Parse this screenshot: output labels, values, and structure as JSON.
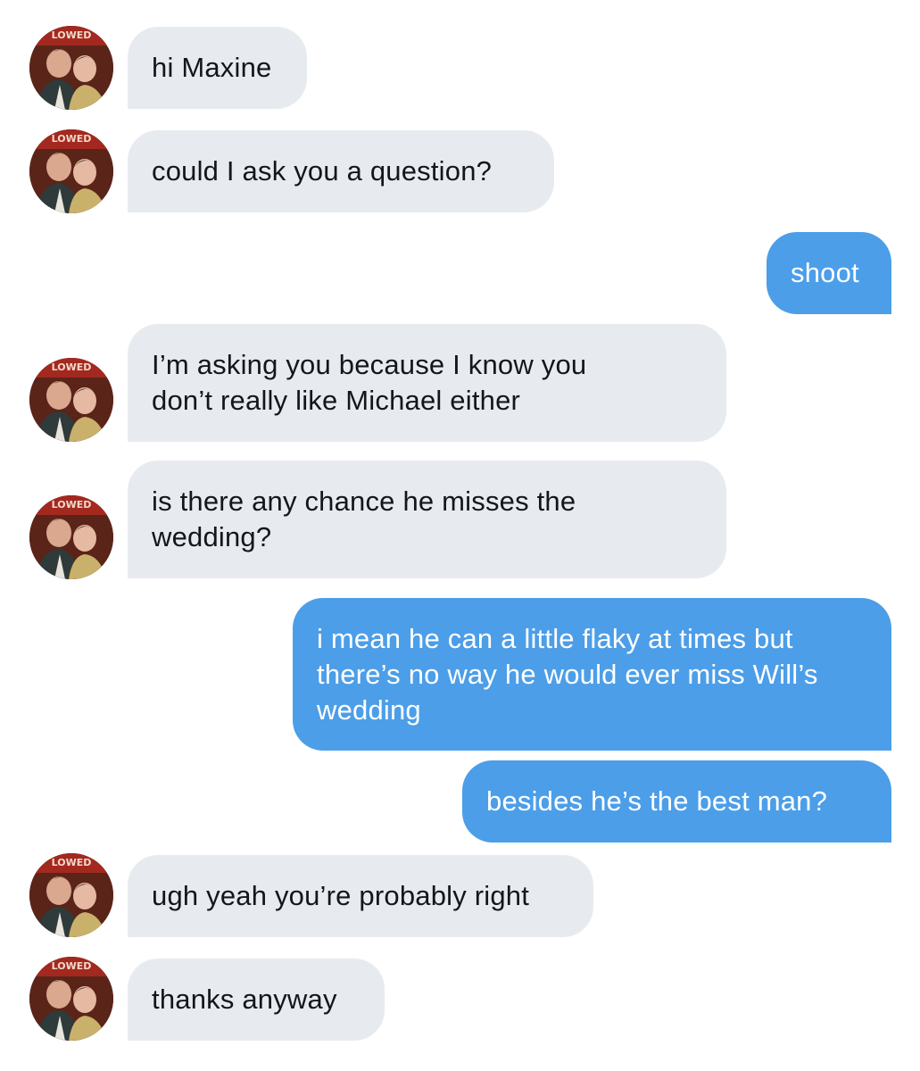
{
  "colors": {
    "incoming_bubble": "#e7ebef",
    "outgoing_bubble": "#4c9ee8",
    "incoming_text": "#14171a",
    "outgoing_text": "#ffffff"
  },
  "avatar": {
    "icon": "avatar-photo-icon",
    "badge_text": "LOWED"
  },
  "conversation": {
    "messages": [
      {
        "sender": "them",
        "text": "hi Maxine"
      },
      {
        "sender": "them",
        "text": "could I ask you a question?"
      },
      {
        "sender": "me",
        "text": "shoot"
      },
      {
        "sender": "them",
        "text": "I’m asking you because I know you\ndon’t really like Michael either"
      },
      {
        "sender": "them",
        "text": "is there any chance he misses the\nwedding?"
      },
      {
        "sender": "me",
        "text": "i mean he can a little flaky at times but\nthere’s no way he would ever miss Will’s\nwedding"
      },
      {
        "sender": "me",
        "text": "besides he’s the best man?"
      },
      {
        "sender": "them",
        "text": "ugh yeah you’re probably right"
      },
      {
        "sender": "them",
        "text": "thanks anyway"
      }
    ]
  }
}
